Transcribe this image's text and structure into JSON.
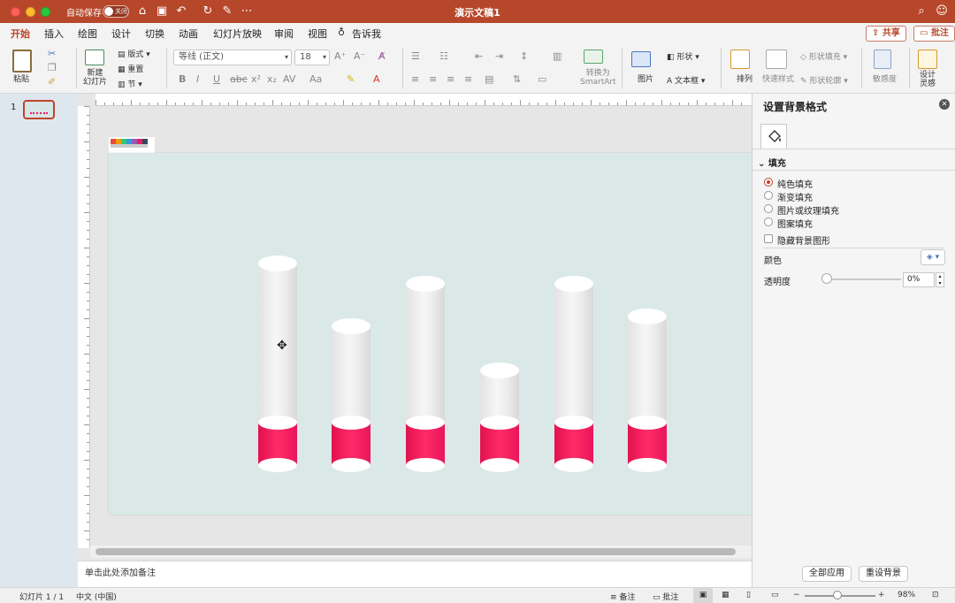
{
  "titlebar": {
    "autosave_label": "自动保存",
    "autosave_state": "关闭",
    "title": "演示文稿1"
  },
  "tabs": [
    "开始",
    "插入",
    "绘图",
    "设计",
    "切换",
    "动画",
    "幻灯片放映",
    "审阅",
    "视图",
    "告诉我"
  ],
  "active_tab": "开始",
  "share_label": "共享",
  "comment_label": "批注",
  "ribbon": {
    "paste": "粘贴",
    "new_slide": "新建\n幻灯片",
    "layout": "版式",
    "reset": "重置",
    "section": "节",
    "font_name": "等线 (正文)",
    "font_size": "18",
    "convert_smartart": "转换为\nSmartArt",
    "picture": "图片",
    "shape": "形状",
    "textbox": "文本框",
    "arrange": "排列",
    "quick_styles": "快速样式",
    "shape_fill": "形状填充",
    "shape_outline": "形状轮廓",
    "sensitivity": "敏感度",
    "design_ideas": "设计\n灵感"
  },
  "thumbnail": {
    "number": "1"
  },
  "notes_placeholder": "单击此处添加备注",
  "pane": {
    "title": "设置背景格式",
    "section": "填充",
    "fill_options": [
      "纯色填充",
      "渐变填充",
      "图片或纹理填充",
      "图案填充"
    ],
    "selected_fill": "纯色填充",
    "hide_bg_graphics": "隐藏背景图形",
    "color_label": "颜色",
    "transparency_label": "透明度",
    "transparency_value": "0%",
    "apply_all": "全部应用",
    "reset_bg": "重设背景"
  },
  "status": {
    "slide": "幻灯片 1 / 1",
    "language": "中文 (中国)",
    "notes": "备注",
    "comments": "批注",
    "zoom": "98%"
  },
  "colors": {
    "accent": "#b7472a",
    "slide_bg": "#dae9e8",
    "cylinder_fill": "#ff2b68"
  }
}
